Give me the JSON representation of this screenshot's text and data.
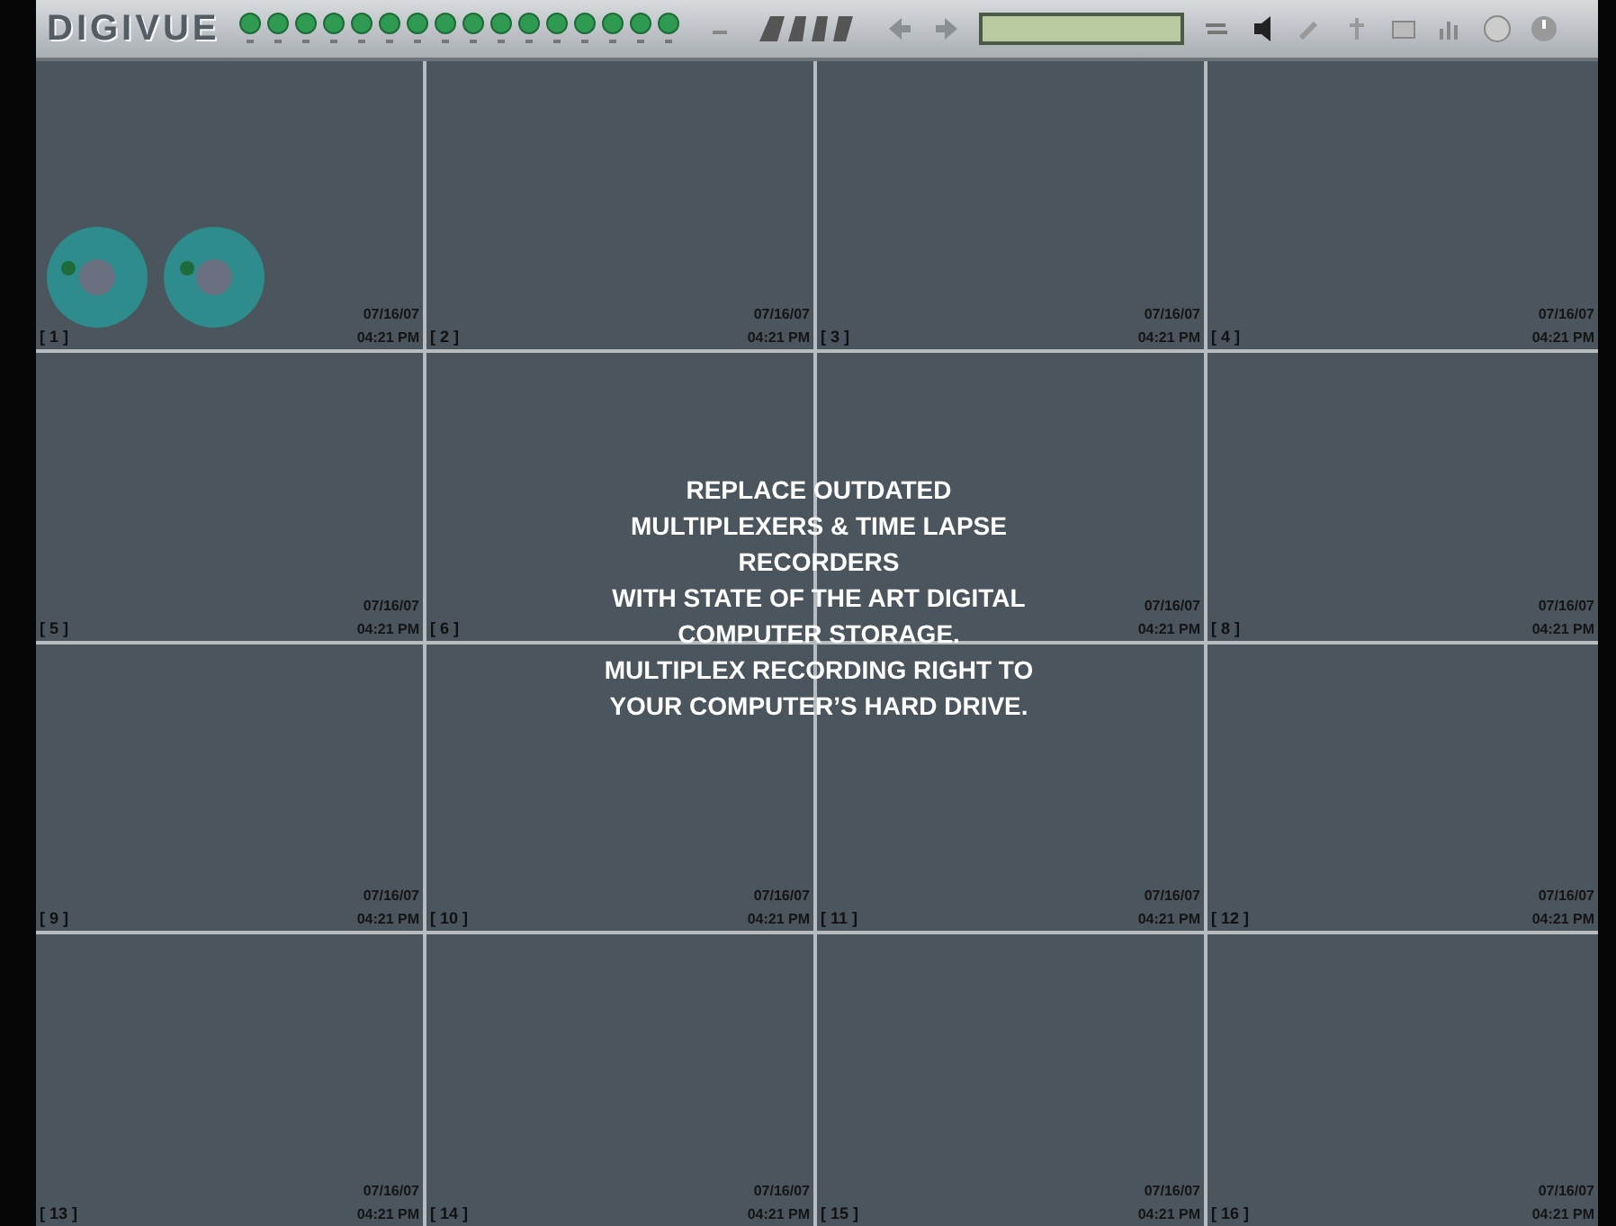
{
  "toolbar": {
    "logo": "DIGIVUE"
  },
  "cells": [
    {
      "label": "[ 1 ]",
      "date": "07/16/07",
      "time": "04:21 PM",
      "kind": "disc"
    },
    {
      "label": "[ 2 ]",
      "date": "07/16/07",
      "time": "04:21 PM",
      "kind": "plain"
    },
    {
      "label": "[ 3 ]",
      "date": "07/16/07",
      "time": "04:21 PM",
      "kind": "plain"
    },
    {
      "label": "[ 4 ]",
      "date": "07/16/07",
      "time": "04:21 PM",
      "kind": "plain"
    },
    {
      "label": "[ 5 ]",
      "date": "07/16/07",
      "time": "04:21 PM",
      "kind": "plain"
    },
    {
      "label": "[ 6 ]",
      "kind": "plain"
    },
    {
      "date": "07/16/07",
      "time": "04:21 PM",
      "kind": "plain"
    },
    {
      "label": "[ 8 ]",
      "date": "07/16/07",
      "time": "04:21 PM",
      "kind": "plain"
    },
    {
      "label": "[ 9 ]",
      "date": "07/16/07",
      "time": "04:21 PM",
      "kind": "plain"
    },
    {
      "label": "[ 10 ]",
      "date": "07/16/07",
      "time": "04:21 PM",
      "kind": "plain"
    },
    {
      "label": "[ 11 ]",
      "date": "07/16/07",
      "time": "04:21 PM",
      "kind": "plain"
    },
    {
      "label": "[ 12 ]",
      "date": "07/16/07",
      "time": "04:21 PM",
      "kind": "plain"
    },
    {
      "label": "[ 13 ]",
      "date": "07/16/07",
      "time": "04:21 PM",
      "kind": "plain"
    },
    {
      "label": "[ 14 ]",
      "date": "07/16/07",
      "time": "04:21 PM",
      "kind": "plain"
    },
    {
      "label": "[ 15 ]",
      "date": "07/16/07",
      "time": "04:21 PM",
      "kind": "plain"
    },
    {
      "label": "[ 16 ]",
      "date": "07/16/07",
      "time": "04:21 PM",
      "kind": "plain"
    }
  ],
  "overlay": {
    "lines": [
      "REPLACE OUTDATED",
      "MULTIPLEXERS & TIME LAPSE",
      "RECORDERS",
      "WITH STATE OF THE ART DIGITAL",
      "COMPUTER STORAGE.",
      "MULTIPLEX RECORDING RIGHT TO",
      "YOUR COMPUTER’S HARD DRIVE."
    ]
  }
}
